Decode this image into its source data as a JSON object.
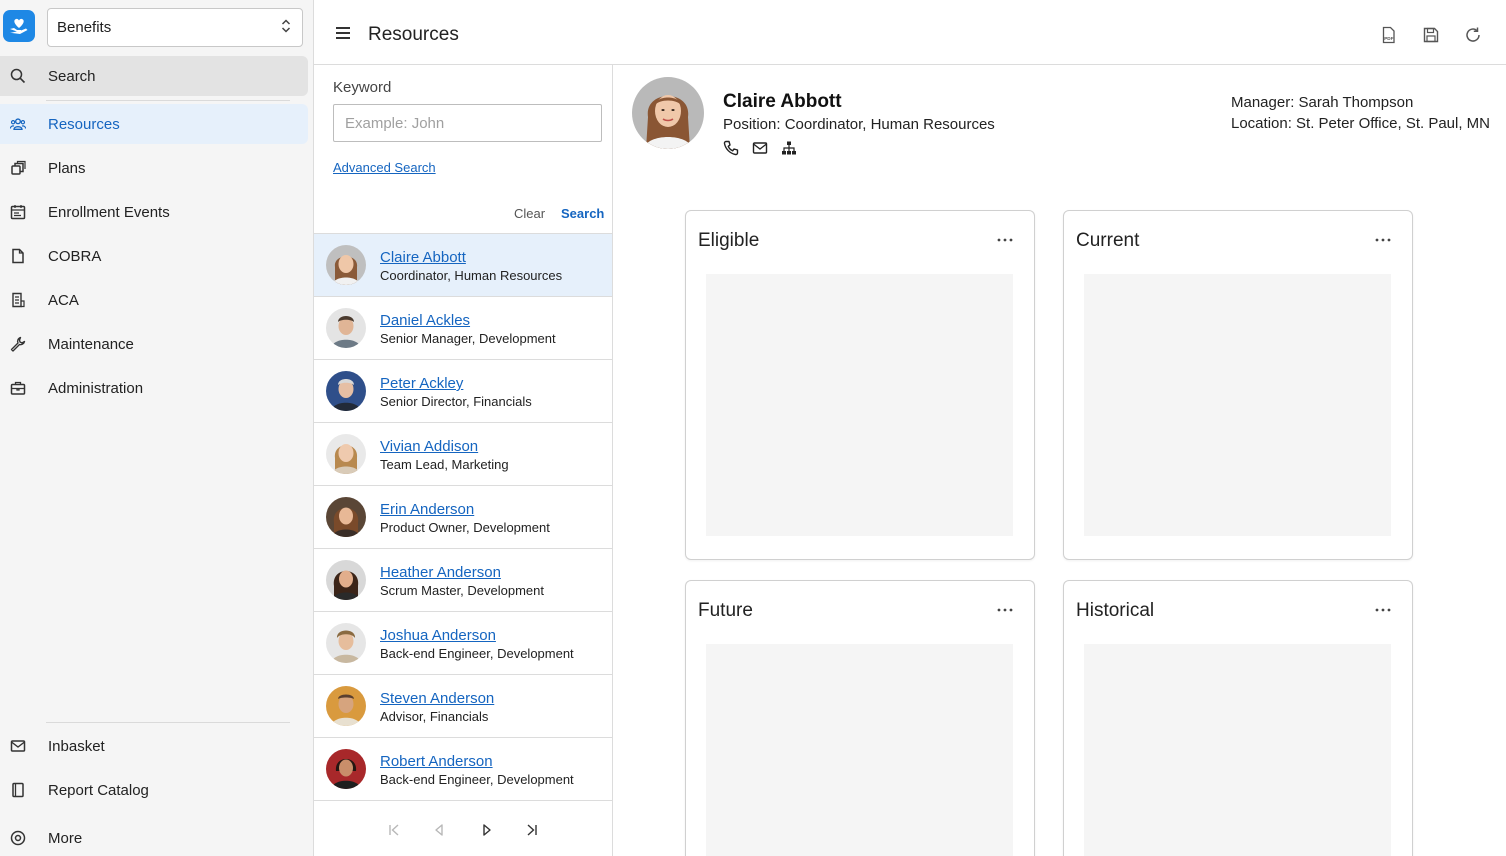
{
  "module": {
    "selected": "Benefits"
  },
  "sidebar": {
    "search_label": "Search",
    "items": [
      {
        "label": "Resources",
        "icon": "people-icon",
        "active": true
      },
      {
        "label": "Plans",
        "icon": "stacked-cards-icon"
      },
      {
        "label": "Enrollment Events",
        "icon": "calendar-icon"
      },
      {
        "label": "COBRA",
        "icon": "document-icon"
      },
      {
        "label": "ACA",
        "icon": "form-list-icon"
      },
      {
        "label": "Maintenance",
        "icon": "wrench-icon"
      },
      {
        "label": "Administration",
        "icon": "briefcase-icon"
      }
    ],
    "bottom_items": [
      {
        "label": "Inbasket",
        "icon": "mail-icon"
      },
      {
        "label": "Report Catalog",
        "icon": "book-icon"
      },
      {
        "label": "More",
        "icon": "settings-circle-icon"
      }
    ]
  },
  "topbar": {
    "title": "Resources"
  },
  "search_panel": {
    "keyword_label": "Keyword",
    "keyword_placeholder": "Example: John",
    "keyword_value": "",
    "advanced_link": "Advanced Search",
    "clear_label": "Clear",
    "search_label": "Search",
    "results": [
      {
        "name": "Claire Abbott",
        "title": "Coordinator, Human Resources",
        "selected": true
      },
      {
        "name": "Daniel Ackles",
        "title": "Senior Manager, Development"
      },
      {
        "name": "Peter Ackley",
        "title": "Senior Director, Financials"
      },
      {
        "name": "Vivian Addison",
        "title": "Team Lead, Marketing"
      },
      {
        "name": "Erin Anderson",
        "title": "Product Owner, Development"
      },
      {
        "name": "Heather Anderson",
        "title": "Scrum Master, Development"
      },
      {
        "name": "Joshua Anderson",
        "title": "Back-end Engineer, Development"
      },
      {
        "name": "Steven Anderson",
        "title": "Advisor, Financials"
      },
      {
        "name": "Robert Anderson",
        "title": "Back-end Engineer, Development"
      }
    ]
  },
  "detail": {
    "name": "Claire Abbott",
    "position": "Position: Coordinator, Human Resources",
    "manager": "Manager: Sarah Thompson",
    "location": "Location: St. Peter Office, St. Paul, MN",
    "cards": [
      {
        "title": "Eligible"
      },
      {
        "title": "Current"
      },
      {
        "title": "Future"
      },
      {
        "title": "Historical"
      }
    ]
  },
  "colors": {
    "accent": "#1565c0",
    "selected_bg": "#e6f0fb",
    "sidebar_bg": "#f5f5f5"
  }
}
